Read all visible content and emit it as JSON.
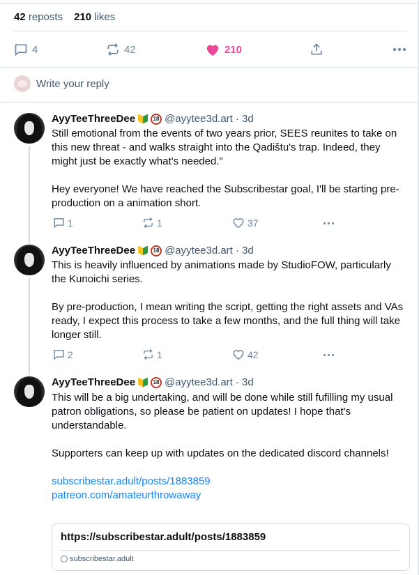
{
  "stats": {
    "reposts_count": "42",
    "reposts_label": "reposts",
    "likes_count": "210",
    "likes_label": "likes"
  },
  "main_actions": {
    "replies": "4",
    "reposts": "42",
    "likes": "210"
  },
  "reply_box": {
    "placeholder": "Write your reply"
  },
  "colors": {
    "accent": "#1083fe",
    "like": "#ec4899",
    "muted": "#6f869f",
    "border": "#d4dbe2"
  },
  "posts": [
    {
      "author": "AyyTeeThreeDee",
      "handle": "@ayytee3d.art",
      "time": "· 3d",
      "paragraphs": [
        "Still emotional from the events of two years prior, SEES reunites to take on this new threat - and walks straight into the Qadištu's trap. Indeed, they might just be exactly what's needed.\"",
        "Hey everyone! We have reached the Subscribestar goal, I'll be starting pre-production on a animation short."
      ],
      "replies": "1",
      "reposts": "1",
      "likes": "37"
    },
    {
      "author": "AyyTeeThreeDee",
      "handle": "@ayytee3d.art",
      "time": "· 3d",
      "paragraphs": [
        "This is heavily influenced by animations made by StudioFOW, particularly the Kunoichi series.",
        "By pre-production, I mean writing the script, getting the right assets and VAs ready, I expect this process to take a few months, and the full thing will take longer still."
      ],
      "replies": "2",
      "reposts": "1",
      "likes": "42"
    },
    {
      "author": "AyyTeeThreeDee",
      "handle": "@ayytee3d.art",
      "time": "· 3d",
      "paragraphs": [
        "This will be a big undertaking, and will be done while still fufilling my usual patron obligations, so please be patient on updates! I hope that's understandable.",
        "Supporters can keep up with updates on the dedicated discord channels!"
      ],
      "links": [
        "subscribestar.adult/posts/1883859",
        "patreon.com/amateurthrowaway"
      ],
      "card": {
        "title": "https://subscribestar.adult/posts/1883859",
        "domain": "subscribestar.adult"
      }
    }
  ]
}
